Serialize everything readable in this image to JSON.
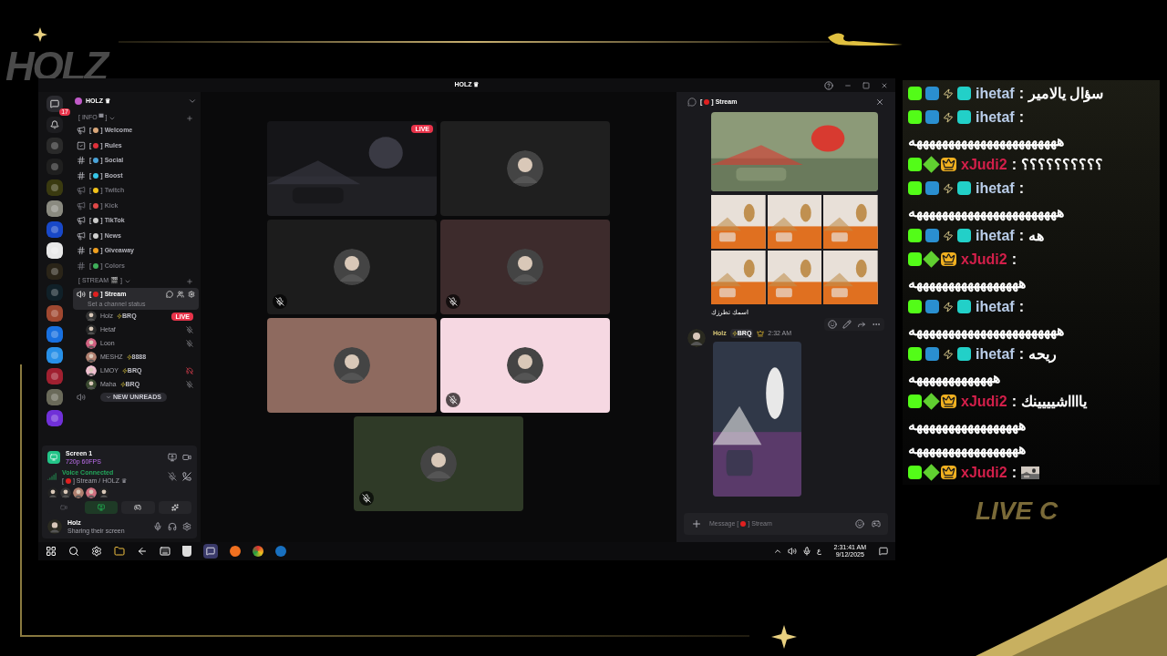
{
  "overlay": {
    "logo": "HOLZ",
    "live_text": "LIVE C"
  },
  "discord": {
    "title": "HOLZ ♛",
    "home_badge": "17",
    "server_name": "HOLZ ♛",
    "brackets": [
      "[",
      "]"
    ],
    "categories": [
      {
        "name": "[ INFO ▀ ]",
        "channels": [
          {
            "name": "Welcome",
            "kind": "announcement",
            "muted": false,
            "color": "#d9a77a"
          },
          {
            "name": "Rules",
            "kind": "rules",
            "muted": false,
            "color": "#e0303a"
          },
          {
            "name": "Social",
            "kind": "text",
            "muted": false,
            "color": "#4aa3d8"
          },
          {
            "name": "Boost",
            "kind": "text",
            "muted": false,
            "color": "#36c6e8"
          },
          {
            "name": "Twitch",
            "kind": "announcement",
            "muted": true,
            "color": "#f2c21b"
          },
          {
            "name": "Kick",
            "kind": "announcement",
            "muted": true,
            "color": "#e04848"
          },
          {
            "name": "TikTok",
            "kind": "announcement",
            "muted": false,
            "color": "#c9c9c9"
          },
          {
            "name": "News",
            "kind": "announcement",
            "muted": false,
            "color": "#d0d0d0"
          },
          {
            "name": "Giveaway",
            "kind": "text",
            "muted": false,
            "color": "#f0a020"
          },
          {
            "name": "Colors",
            "kind": "text",
            "muted": true,
            "color": "#3fae5a"
          }
        ]
      },
      {
        "name": "[ STREAM 🎬 ]"
      }
    ],
    "voice_channel": {
      "name": "Stream",
      "status": "Set a channel status",
      "selected": true
    },
    "members": [
      {
        "name": "Holz",
        "tag": "BRQ",
        "live": "LIVE",
        "kind": "live"
      },
      {
        "name": "Hetaf",
        "kind": "muted"
      },
      {
        "name": "Loon",
        "kind": "muted"
      },
      {
        "name": "MESHZ",
        "tag": "8888",
        "kind": "plain"
      },
      {
        "name": "LMOY",
        "tag": "BRQ",
        "kind": "deafened"
      },
      {
        "name": "Maha",
        "tag": "BRQ",
        "kind": "muted"
      }
    ],
    "new_unreads": "NEW UNREADS",
    "screen": {
      "title": "Screen 1",
      "quality": "720p 60FPS"
    },
    "voice": {
      "status": "Voice Connected",
      "channel": "Stream / HOLZ ♛"
    },
    "user": {
      "name": "Holz",
      "status": "Sharing their screen"
    },
    "tiles": [
      {
        "kind": "screen",
        "badge": "LIVE"
      },
      {
        "kind": "avatar",
        "color": "#1f1f1f",
        "muted": false
      },
      {
        "kind": "avatar",
        "color": "#1c1c1c",
        "muted": true
      },
      {
        "kind": "avatar",
        "color": "#3d2b2c",
        "muted": true
      },
      {
        "kind": "avatar",
        "color": "#8e6a5f",
        "muted": false
      },
      {
        "kind": "avatar",
        "color": "#f6d8e2",
        "muted": true
      },
      {
        "kind": "avatar",
        "color": "#2f3a27",
        "muted": true
      }
    ],
    "chat": {
      "channel": "Stream",
      "caption": "اسمك تطرزك",
      "author": "Holz",
      "tag": "BRQ",
      "time": "2:32 AM",
      "placeholder": "Message",
      "input_channel": "Stream"
    },
    "taskbar": {
      "time": "2:31:41 AM",
      "date": "9/12/2025",
      "lang": "ع"
    }
  },
  "stream_chat": [
    {
      "user": "ihetaf",
      "color": "#b9cde9",
      "kind": "mod",
      "text": "سؤال يالامير"
    },
    {
      "user": "ihetaf",
      "color": "#b9cde9",
      "kind": "mod",
      "lines": [
        "هههههههههههههههههههههههه"
      ]
    },
    {
      "user": "xJudi2",
      "color": "#d31f4a",
      "kind": "vip",
      "text": "؟؟؟؟؟؟؟؟؟؟"
    },
    {
      "user": "ihetaf",
      "color": "#b9cde9",
      "kind": "mod",
      "lines": [
        "هههههههههههههههههههههههه"
      ]
    },
    {
      "user": "ihetaf",
      "color": "#b9cde9",
      "kind": "mod",
      "text": "هه"
    },
    {
      "user": "xJudi2",
      "color": "#d31f4a",
      "kind": "vip",
      "lines": [
        "هههههههههههههههههه"
      ]
    },
    {
      "user": "ihetaf",
      "color": "#b9cde9",
      "kind": "mod",
      "lines": [
        "هههههههههههههههههههههههه"
      ]
    },
    {
      "user": "ihetaf",
      "color": "#b9cde9",
      "kind": "mod",
      "text": "ريحه",
      "lines": [
        "هههههههههههههه"
      ]
    },
    {
      "user": "xJudi2",
      "color": "#d31f4a",
      "kind": "vip",
      "text": "يااااشيييينك",
      "lines": [
        "هههههههههههههههههه",
        "هههههههههههههههههه"
      ]
    },
    {
      "user": "xJudi2",
      "color": "#d31f4a",
      "kind": "vip",
      "emote": true
    }
  ],
  "chat_separator": ":"
}
